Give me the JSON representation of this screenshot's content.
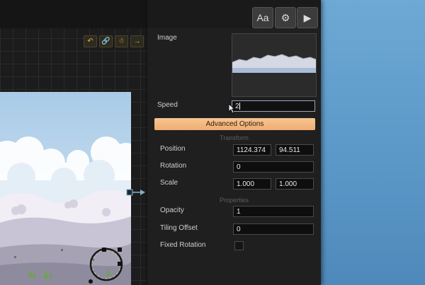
{
  "toolbar": {
    "font_button_label": "Aa",
    "settings_icon": "gear-icon",
    "play_icon": "play-icon"
  },
  "canvas_tools": [
    {
      "icon": "undo-icon"
    },
    {
      "icon": "link-icon"
    },
    {
      "icon": "bug-icon"
    },
    {
      "icon": "arrow-right-icon"
    }
  ],
  "properties": {
    "image_label": "Image",
    "speed_label": "Speed",
    "speed_value": "2",
    "advanced_options_label": "Advanced Options",
    "transform_section": "Transform",
    "position_label": "Position",
    "position_x": "1124.374",
    "position_y": "94.511",
    "rotation_label": "Rotation",
    "rotation_value": "0",
    "scale_label": "Scale",
    "scale_x": "1.000",
    "scale_y": "1.000",
    "properties_section": "Properties",
    "opacity_label": "Opacity",
    "opacity_value": "1",
    "tiling_offset_label": "Tiling Offset",
    "tiling_offset_value": "0",
    "fixed_rotation_label": "Fixed Rotation",
    "fixed_rotation_checked": false
  },
  "colors": {
    "accent_button": "#f3b57c",
    "panel_bg": "#1f1f1f",
    "backdrop": "#5b98c8"
  }
}
